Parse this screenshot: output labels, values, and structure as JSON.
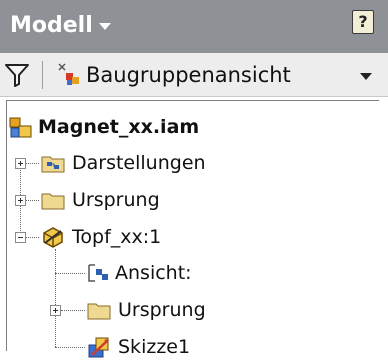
{
  "header": {
    "title": "Modell",
    "help_label": "?"
  },
  "toolbar": {
    "view_label": "Baugruppenansicht"
  },
  "tree": {
    "root": "Magnet_xx.iam",
    "items": [
      {
        "label": "Darstellungen"
      },
      {
        "label": "Ursprung"
      },
      {
        "label": "Topf_xx:1"
      }
    ],
    "children": [
      {
        "label": "Ansicht:"
      },
      {
        "label": "Ursprung"
      },
      {
        "label": "Skizze1"
      }
    ]
  },
  "icons": [
    "filter-icon",
    "view-rep-icon",
    "assembly-icon",
    "representations-icon",
    "folder-icon",
    "part-icon",
    "view-icon",
    "sketch-icon"
  ],
  "colors": {
    "header_bg": "#8e9196",
    "toolbar_bg": "#ededed",
    "folder": "#efd88f"
  }
}
